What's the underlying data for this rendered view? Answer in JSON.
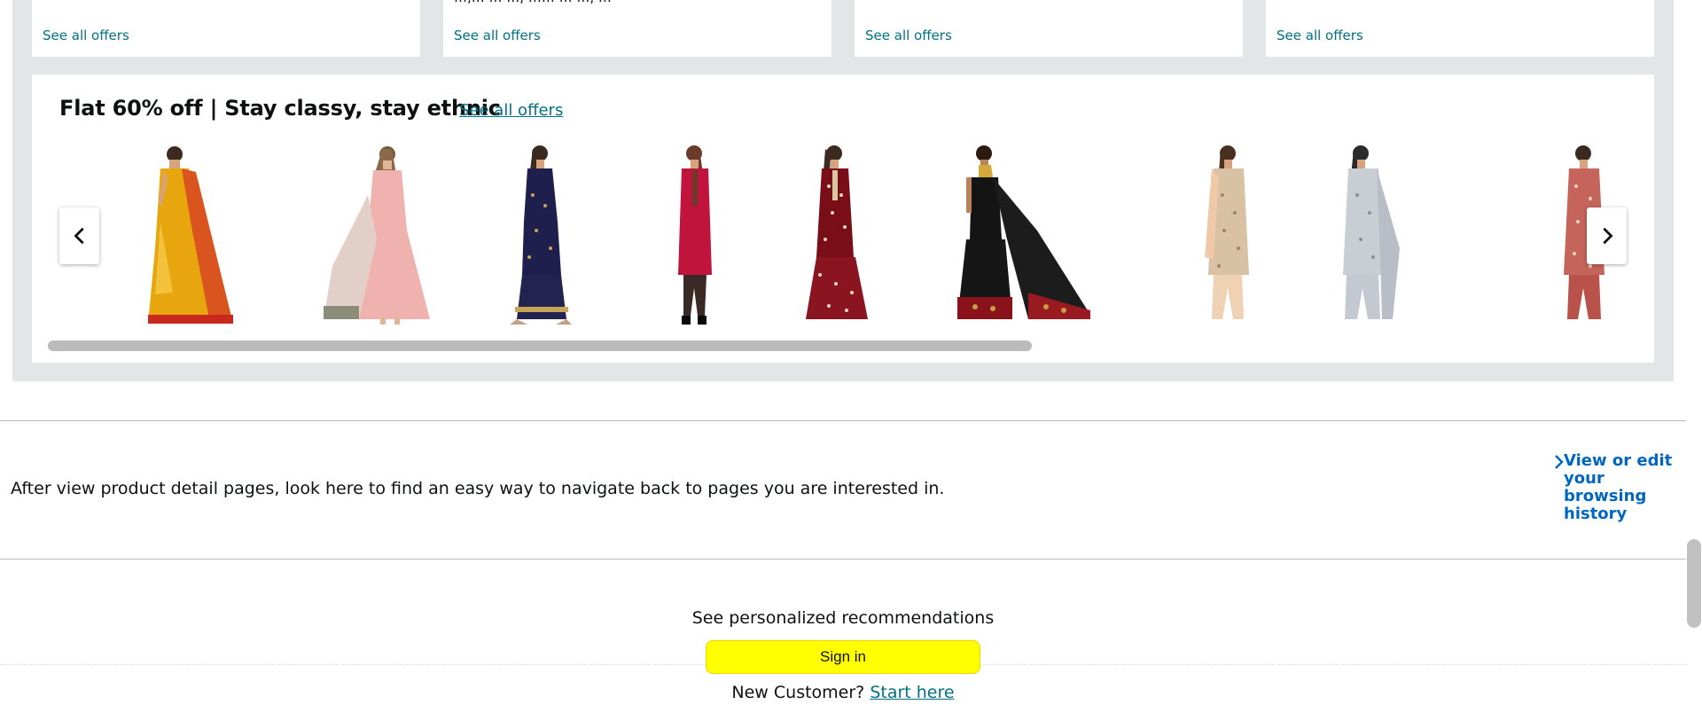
{
  "top_cards": [
    {
      "link": "See all offers",
      "clipped_text": ""
    },
    {
      "link": "See all offers",
      "clipped_text": "…,… … …, …… … …, …"
    },
    {
      "link": "See all offers",
      "clipped_text": ""
    },
    {
      "link": "See all offers",
      "clipped_text": ""
    }
  ],
  "ethnic": {
    "title": "Flat 60% off | Stay classy, stay ethnic",
    "see_all": "See all offers",
    "products": [
      {
        "name": "yellow-saree"
      },
      {
        "name": "pink-anarkali"
      },
      {
        "name": "navy-kurta-set"
      },
      {
        "name": "red-kurta"
      },
      {
        "name": "maroon-printed-set"
      },
      {
        "name": "black-red-saree"
      },
      {
        "name": "peach-kurta-set"
      },
      {
        "name": "grey-kurta-set"
      },
      {
        "name": "red-printed-kurta"
      }
    ],
    "scroll_fraction": 0.62
  },
  "browsing_history": {
    "message": "After view product detail pages, look here to find an easy way to navigate back to pages you are interested in.",
    "link_label": "View or edit your browsing history"
  },
  "signin": {
    "title": "See personalized recommendations",
    "button": "Sign in",
    "new_customer": "New Customer?",
    "start_here": "Start here"
  },
  "colors": {
    "link": "#007185",
    "history_link": "#0066c0",
    "signin_button": "#ffff00",
    "band": "#e3e6e6"
  },
  "icons": {
    "prev": "chevron-left-icon",
    "next": "chevron-right-icon",
    "history": "chevron-right-icon"
  }
}
